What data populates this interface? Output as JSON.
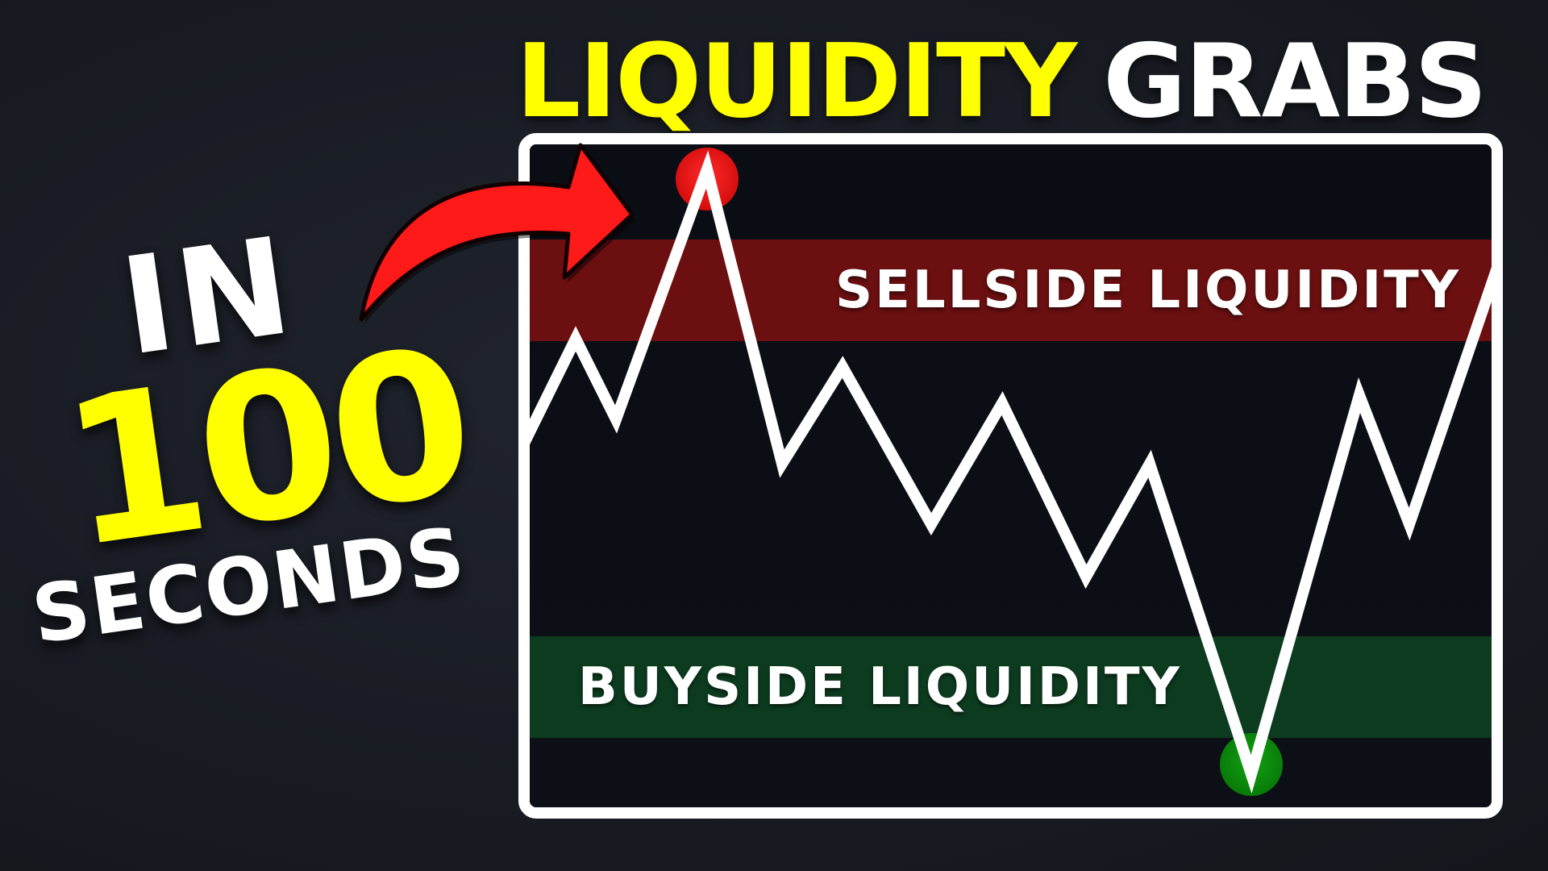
{
  "title": {
    "part1": "LIQUIDITY",
    "part2": "GRABS"
  },
  "left_text": {
    "line1": "IN",
    "line2": "100",
    "line3": "SECONDS"
  },
  "zones": {
    "sell_label": "SELLSIDE LIQUIDITY",
    "buy_label": "BUYSIDE LIQUIDITY"
  },
  "colors": {
    "title_accent": "#ffff00",
    "sell_zone": "#6b0f10",
    "buy_zone": "#0c3b1f",
    "high_marker": "#e81010",
    "low_marker": "#0b8a0b",
    "arrow": "#ff1a1a"
  },
  "icons": {
    "pointer": "curved-arrow-icon",
    "high": "red-dot-icon",
    "low": "green-dot-icon"
  }
}
